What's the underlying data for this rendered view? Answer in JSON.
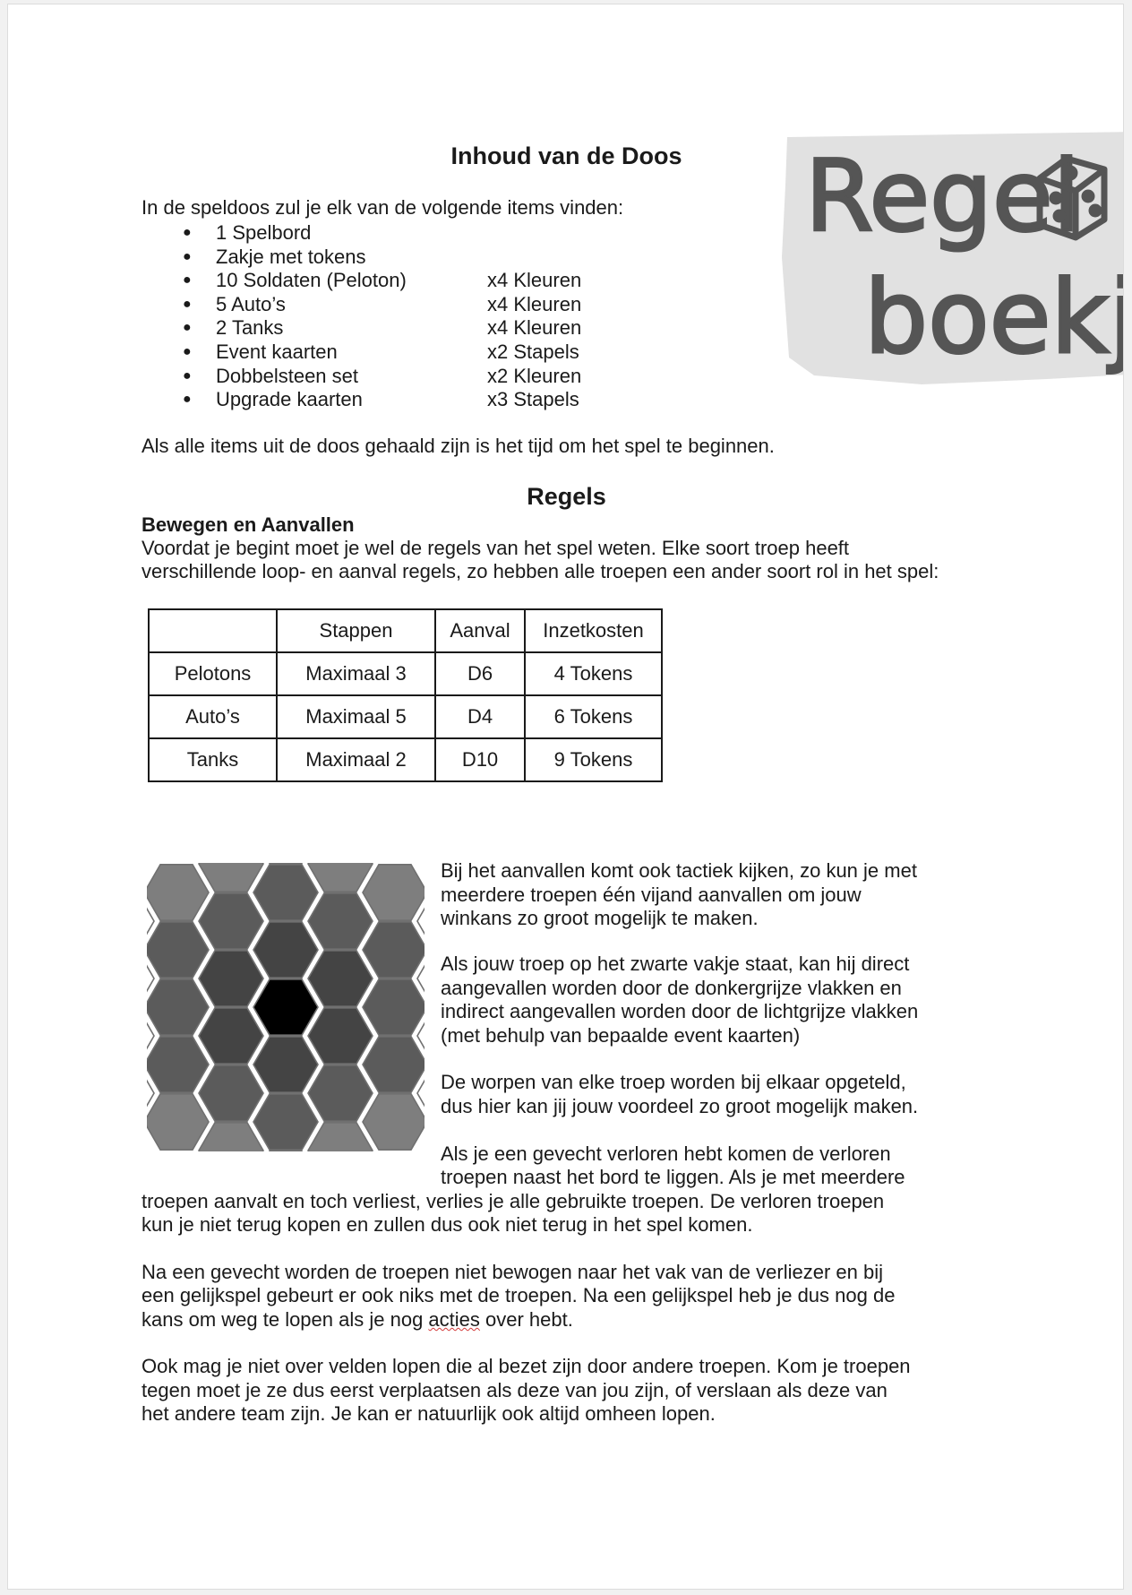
{
  "logo": {
    "line1": "Regel",
    "line2": "boekje",
    "icon": "dice-icon"
  },
  "box_contents": {
    "title": "Inhoud van de Doos",
    "intro": "In de speldoos zul je elk van de volgende items vinden:",
    "items": [
      {
        "name": "1 Spelbord",
        "qty": ""
      },
      {
        "name": "Zakje met tokens",
        "qty": ""
      },
      {
        "name": "10 Soldaten (Peloton)",
        "qty": "x4 Kleuren"
      },
      {
        "name": "5 Auto’s",
        "qty": "x4 Kleuren"
      },
      {
        "name": "2 Tanks",
        "qty": "x4 Kleuren"
      },
      {
        "name": "Event kaarten",
        "qty": "x2 Stapels"
      },
      {
        "name": "Dobbelsteen set",
        "qty": "x2 Kleuren"
      },
      {
        "name": "Upgrade kaarten",
        "qty": "x3 Stapels"
      }
    ],
    "bullet": "●",
    "outro": "Als alle items uit de doos gehaald zijn is het tijd om het spel te beginnen."
  },
  "rules": {
    "title": "Regels",
    "subtitle": "Bewegen en Aanvallen",
    "intro_line1": "Voordat je begint moet je wel de regels van het spel weten. Elke soort troep heeft",
    "intro_line2": "verschillende loop- en aanval regels, zo hebben alle troepen een ander soort rol in het spel:",
    "table": {
      "headers": [
        "",
        "Stappen",
        "Aanval",
        "Inzetkosten"
      ],
      "rows": [
        [
          "Pelotons",
          "Maximaal 3",
          "D6",
          "4 Tokens"
        ],
        [
          "Auto’s",
          "Maximaal 5",
          "D4",
          "6 Tokens"
        ],
        [
          "Tanks",
          "Maximaal 2",
          "D10",
          "9 Tokens"
        ]
      ]
    },
    "hex_colors": {
      "center": "#000000",
      "adjacent": "#444444",
      "ring1": "#5b5b5b",
      "ring2": "#7e7e7e",
      "outline": "#707070"
    },
    "side_paragraphs": [
      [
        "Bij het aanvallen komt ook tactiek kijken, zo kun je met",
        "meerdere troepen één vijand aanvallen om jouw",
        "winkans zo groot mogelijk te maken."
      ],
      [
        "Als jouw troep op het zwarte vakje staat, kan hij direct",
        "aangevallen worden door de donkergrijze vlakken en",
        "indirect aangevallen worden door de lichtgrijze vlakken",
        "(met behulp van bepaalde event kaarten)"
      ],
      [
        "De worpen van elke troep worden bij elkaar opgeteld,",
        "dus hier kan jij jouw voordeel zo groot mogelijk maken."
      ]
    ],
    "lost_p_line1": "Als je een gevecht verloren hebt komen de verloren",
    "lost_p_line2": "troepen naast het bord te liggen. Als je met meerdere",
    "lost_p_line3": "troepen aanvalt en toch verliest, verlies je alle gebruikte troepen. De verloren troepen",
    "lost_p_line4": "kun je niet terug kopen en zullen dus ook niet terug in het spel komen.",
    "after_p_line1": "Na een gevecht worden de troepen niet bewogen naar het vak van de verliezer en bij",
    "after_p_line2": "een gelijkspel gebeurt er ook niks met de troepen. Na een gelijkspel heb je dus nog de",
    "after_p_line3_pre": "kans om weg te lopen als je nog ",
    "after_p_line3_word": "acties",
    "after_p_line3_post": " over hebt.",
    "block_p_line1": "Ook mag je niet over velden lopen die al bezet zijn door andere troepen. Kom je troepen",
    "block_p_line2": "tegen moet je ze dus eerst verplaatsen als deze van jou zijn, of verslaan als deze van",
    "block_p_line3": "het andere team zijn. Je kan er natuurlijk ook altijd omheen lopen."
  }
}
